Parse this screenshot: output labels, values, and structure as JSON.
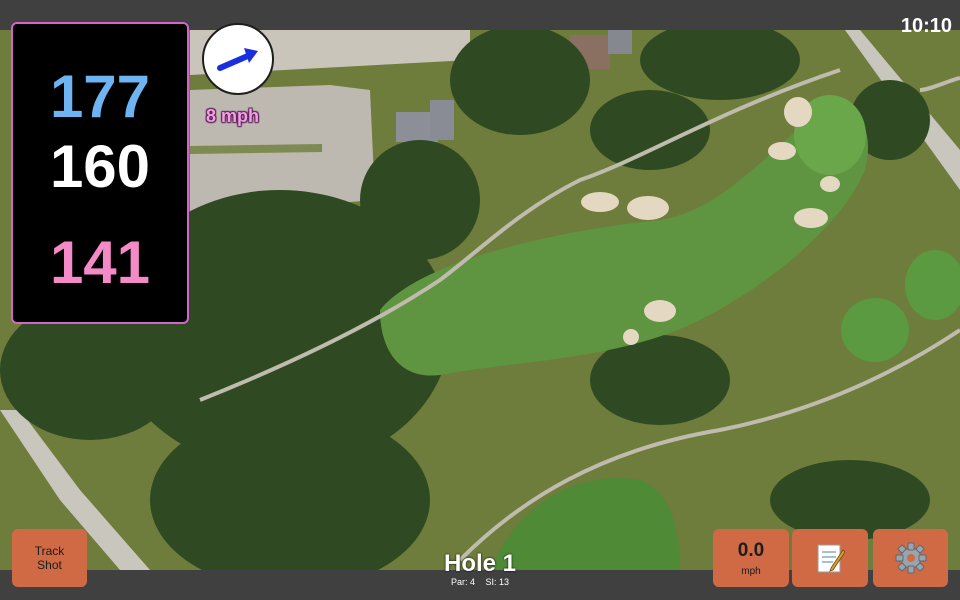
{
  "status": {
    "time": "10:10"
  },
  "distances": {
    "back": "177",
    "middle": "160",
    "front": "141"
  },
  "wind": {
    "speed": "8 mph",
    "icon": "wind-arrow-icon"
  },
  "hole": {
    "title": "Hole 1",
    "par": "Par: 4",
    "stroke_index": "SI: 13"
  },
  "buttons": {
    "track_shot": "Track Shot",
    "speed_value": "0.0",
    "speed_unit": "mph",
    "notes_icon": "notepad-icon",
    "settings_icon": "gear-icon"
  },
  "colors": {
    "back": "#6fb4f2",
    "middle": "#ffffff",
    "front": "#f48bc8",
    "button": "#cf6a45",
    "wind": "#f0a0e0"
  }
}
